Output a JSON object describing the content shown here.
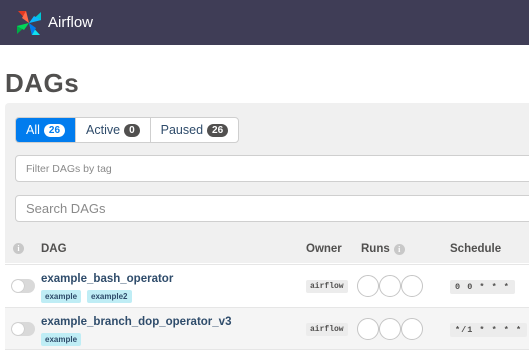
{
  "navbar": {
    "brand": "Airflow",
    "bg": "#3f3d56"
  },
  "page": {
    "title": "DAGs"
  },
  "filters": {
    "tabs": [
      {
        "label": "All",
        "count": "26",
        "active": true
      },
      {
        "label": "Active",
        "count": "0",
        "active": false
      },
      {
        "label": "Paused",
        "count": "26",
        "active": false
      }
    ],
    "tag_placeholder": "Filter DAGs by tag",
    "search_placeholder": "Search DAGs"
  },
  "table": {
    "headers": {
      "dag": "DAG",
      "owner": "Owner",
      "runs": "Runs",
      "schedule": "Schedule"
    },
    "rows": [
      {
        "dag_id": "example_bash_operator",
        "tags": [
          "example",
          "example2"
        ],
        "owner": "airflow",
        "schedule": "0 0 * * *"
      },
      {
        "dag_id": "example_branch_dop_operator_v3",
        "tags": [
          "example"
        ],
        "owner": "airflow",
        "schedule": "*/1 * * * *"
      }
    ]
  },
  "colors": {
    "accent": "#017cee",
    "tag_bg": "#bfedf5",
    "link": "#2f4c6b"
  }
}
